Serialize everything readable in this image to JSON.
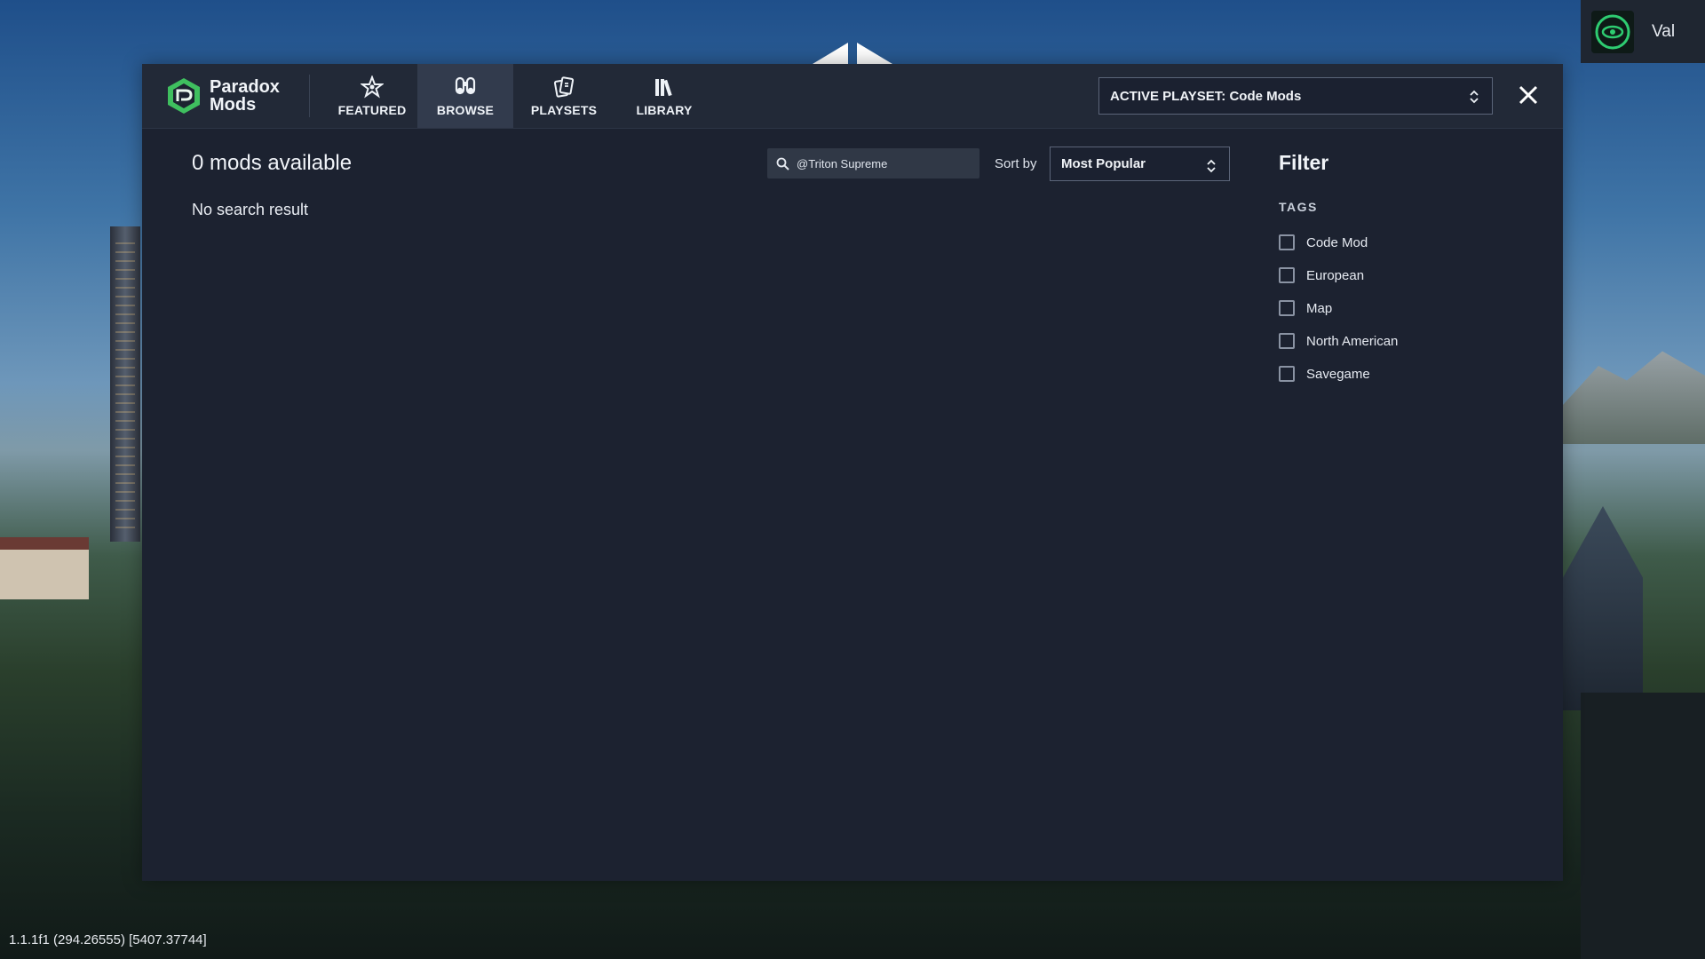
{
  "user": {
    "name": "Val"
  },
  "logo": {
    "line1": "Paradox",
    "line2": "Mods"
  },
  "tabs": [
    {
      "label": "FEATURED",
      "icon": "star-icon"
    },
    {
      "label": "BROWSE",
      "icon": "binoculars-icon",
      "active": true
    },
    {
      "label": "PLAYSETS",
      "icon": "cards-icon"
    },
    {
      "label": "LIBRARY",
      "icon": "books-icon"
    }
  ],
  "playset": {
    "label": "ACTIVE PLAYSET: Code Mods"
  },
  "browse": {
    "count_text": "0 mods available",
    "empty_text": "No search result",
    "search_value": "@Triton Supreme",
    "sort_label": "Sort by",
    "sort_value": "Most Popular"
  },
  "filter": {
    "title": "Filter",
    "tags_heading": "TAGS",
    "tags": [
      {
        "label": "Code Mod",
        "checked": false
      },
      {
        "label": "European",
        "checked": false
      },
      {
        "label": "Map",
        "checked": false
      },
      {
        "label": "North American",
        "checked": false
      },
      {
        "label": "Savegame",
        "checked": false
      }
    ]
  },
  "version": "1.1.1f1 (294.26555) [5407.37744]",
  "colors": {
    "panel": "#1c2230",
    "topbar": "#222937",
    "active_tab": "#323b4d",
    "logo_green": "#3fbf5f"
  }
}
